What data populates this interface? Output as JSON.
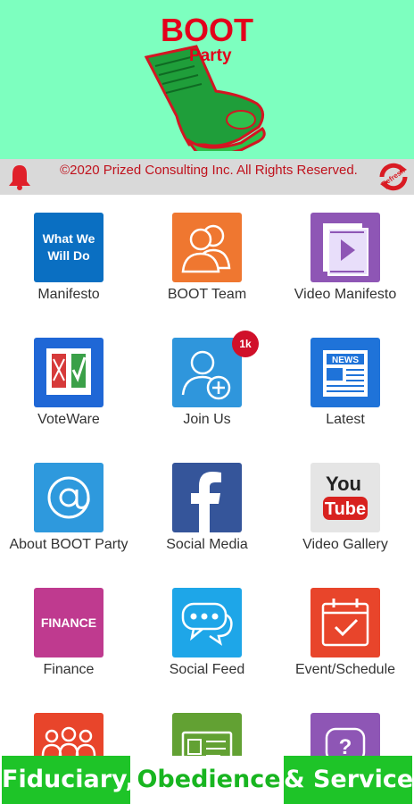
{
  "header": {
    "logo_title": "BOOT",
    "logo_subtitle": "Party"
  },
  "status_bar": {
    "copyright": "©2020 Prized Consulting Inc. All Rights Reserved.",
    "refresh_label": "Refresh",
    "bell_icon": "bell-icon"
  },
  "tiles": [
    {
      "label": "Manifesto",
      "icon_text": "What We Will Do",
      "icon": "manifesto-icon",
      "color": "#0a6fc2"
    },
    {
      "label": "BOOT Team",
      "icon": "team-icon",
      "color": "#ef7730"
    },
    {
      "label": "Video Manifesto",
      "icon": "video-document-icon",
      "color": "#8e56b5"
    },
    {
      "label": "VoteWare",
      "icon": "ballot-icon",
      "color": "#1f67d6"
    },
    {
      "label": "Join Us",
      "icon": "add-user-icon",
      "color": "#2f96dc",
      "badge": "1k"
    },
    {
      "label": "Latest",
      "icon": "news-icon",
      "color": "#1f73d9"
    },
    {
      "label": "About BOOT Party",
      "icon": "at-sign-icon",
      "color": "#2e99dd"
    },
    {
      "label": "Social Media",
      "icon": "facebook-icon",
      "color": "#35559a"
    },
    {
      "label": "Video Gallery",
      "icon": "youtube-icon",
      "color": "#d8d8d8"
    },
    {
      "label": "Finance",
      "icon_text": "FINANCE",
      "icon": "finance-icon",
      "color": "#bf3a8f"
    },
    {
      "label": "Social Feed",
      "icon": "chat-bubbles-icon",
      "color": "#1ea6e8"
    },
    {
      "label": "Event/Schedule",
      "icon": "calendar-icon",
      "color": "#e8452b"
    },
    {
      "label": "",
      "icon": "group-icon",
      "color": "#e8452b"
    },
    {
      "label": "",
      "icon": "id-card-icon",
      "color": "#62a133"
    },
    {
      "label": "",
      "icon": "help-icon",
      "color": "#8e56b5"
    }
  ],
  "footer": {
    "slogan_1": "Fiduciary,",
    "slogan_2": "Obedience",
    "slogan_3": "& Service"
  }
}
